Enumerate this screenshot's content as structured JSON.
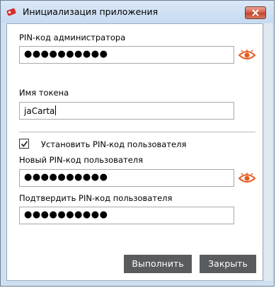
{
  "window": {
    "title": "Инициализация приложения"
  },
  "admin_pin": {
    "label": "PIN-код администратора",
    "value": "●●●●●●●●●●"
  },
  "token_name": {
    "label": "Имя токена",
    "value": "jaCarta"
  },
  "set_user_pin": {
    "label": "Установить PIN-код пользователя",
    "checked": true
  },
  "new_user_pin": {
    "label": "Новый PIN-код пользователя",
    "value": "●●●●●●●●●●"
  },
  "confirm_user_pin": {
    "label": "Подтвердить PIN-код пользователя",
    "value": "●●●●●●●●●●"
  },
  "buttons": {
    "execute": "Выполнить",
    "close": "Закрыть"
  },
  "colors": {
    "accent": "#e8591c",
    "button_bg": "#595c5f",
    "titlebar": "#c6dbf1",
    "close_button": "#c2432a"
  },
  "icons": {
    "app": "token-icon",
    "close": "close-icon",
    "show_password": "eye-icon",
    "check": "checkmark-icon"
  }
}
